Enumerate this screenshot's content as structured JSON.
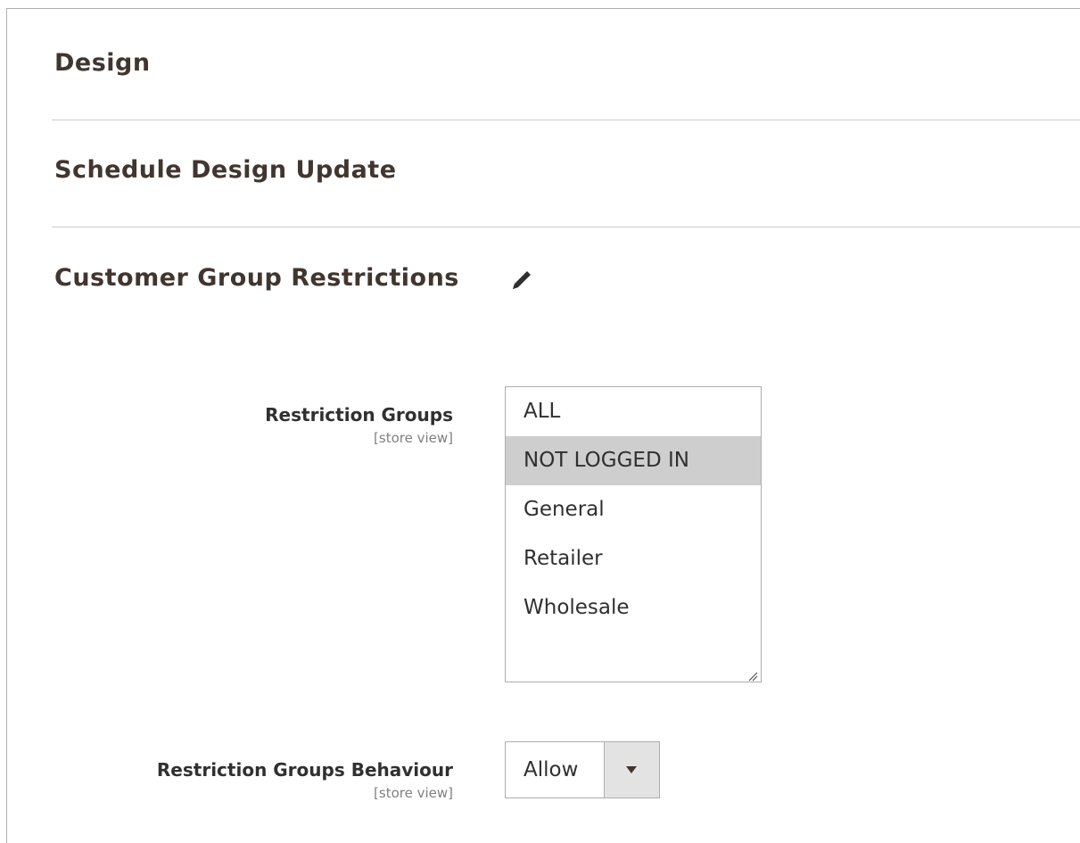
{
  "sections": {
    "design": "Design",
    "schedule": "Schedule Design Update",
    "restrictions": "Customer Group Restrictions"
  },
  "restriction_groups": {
    "label": "Restriction Groups",
    "scope": "[store view]",
    "options": [
      "ALL",
      "NOT LOGGED IN",
      "General",
      "Retailer",
      "Wholesale"
    ],
    "selected": "NOT LOGGED IN"
  },
  "restriction_behaviour": {
    "label": "Restriction Groups Behaviour",
    "scope": "[store view]",
    "value": "Allow"
  },
  "icons": {
    "edit": "pencil-icon",
    "dropdown": "triangle-down-icon",
    "resize": "resize-handle-icon"
  }
}
